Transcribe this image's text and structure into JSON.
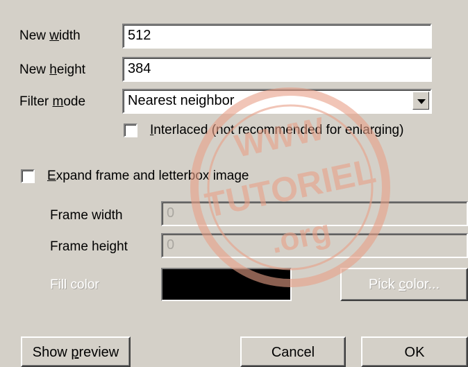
{
  "form": {
    "new_width": {
      "label_pre": "New ",
      "label_ul": "w",
      "label_post": "idth",
      "value": "512"
    },
    "new_height": {
      "label_pre": "New ",
      "label_ul": "h",
      "label_post": "eight",
      "value": "384"
    },
    "filter_mode": {
      "label_pre": "Filter ",
      "label_ul": "m",
      "label_post": "ode",
      "value": "Nearest neighbor"
    },
    "interlaced": {
      "label_ul": "I",
      "label_post": "nterlaced (not recommended for enlarging)",
      "checked": false
    },
    "expand": {
      "label_ul": "E",
      "label_post": "xpand frame and letterbox image",
      "checked": false
    },
    "frame_width": {
      "label": "Frame width",
      "value": "0"
    },
    "frame_height": {
      "label": "Frame height",
      "value": "0"
    },
    "fill_color": {
      "label": "Fill color",
      "color": "#000000"
    },
    "pick_color": {
      "label_pre": "Pick ",
      "label_ul": "c",
      "label_post": "olor..."
    }
  },
  "buttons": {
    "show_preview": {
      "label_pre": "Show ",
      "label_ul": "p",
      "label_post": "review"
    },
    "cancel": "Cancel",
    "ok": "OK"
  },
  "watermark": {
    "top": "WWW",
    "middle": "TUTORIEL",
    "bottom": ".org",
    "color": "#e8a088"
  }
}
